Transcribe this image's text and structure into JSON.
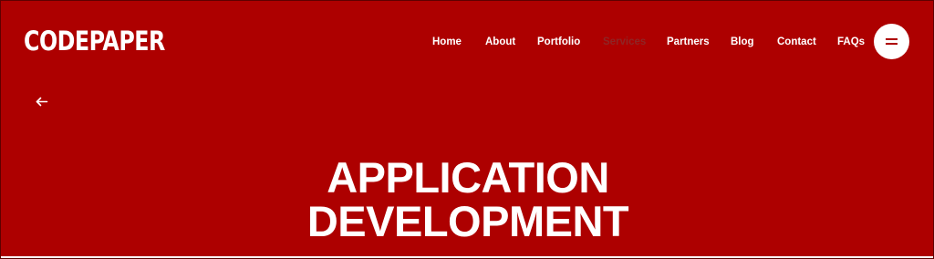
{
  "brand": {
    "logo_text": "CODEPAPER"
  },
  "nav": {
    "items": [
      {
        "label": "Home",
        "active": false
      },
      {
        "label": "About",
        "active": false
      },
      {
        "label": "Portfolio",
        "active": false
      },
      {
        "label": "Services",
        "active": true
      },
      {
        "label": "Partners",
        "active": false
      },
      {
        "label": "Blog",
        "active": false
      },
      {
        "label": "Contact",
        "active": false
      },
      {
        "label": "FAQs",
        "active": false
      }
    ]
  },
  "icons": {
    "menu": "menu-icon",
    "back": "arrow-left-icon"
  },
  "hero": {
    "title_line1": "APPLICATION",
    "title_line2": "DEVELOPMENT"
  },
  "colors": {
    "background": "#ad0000",
    "text": "#ffffff",
    "nav_active": "#8f2525"
  }
}
